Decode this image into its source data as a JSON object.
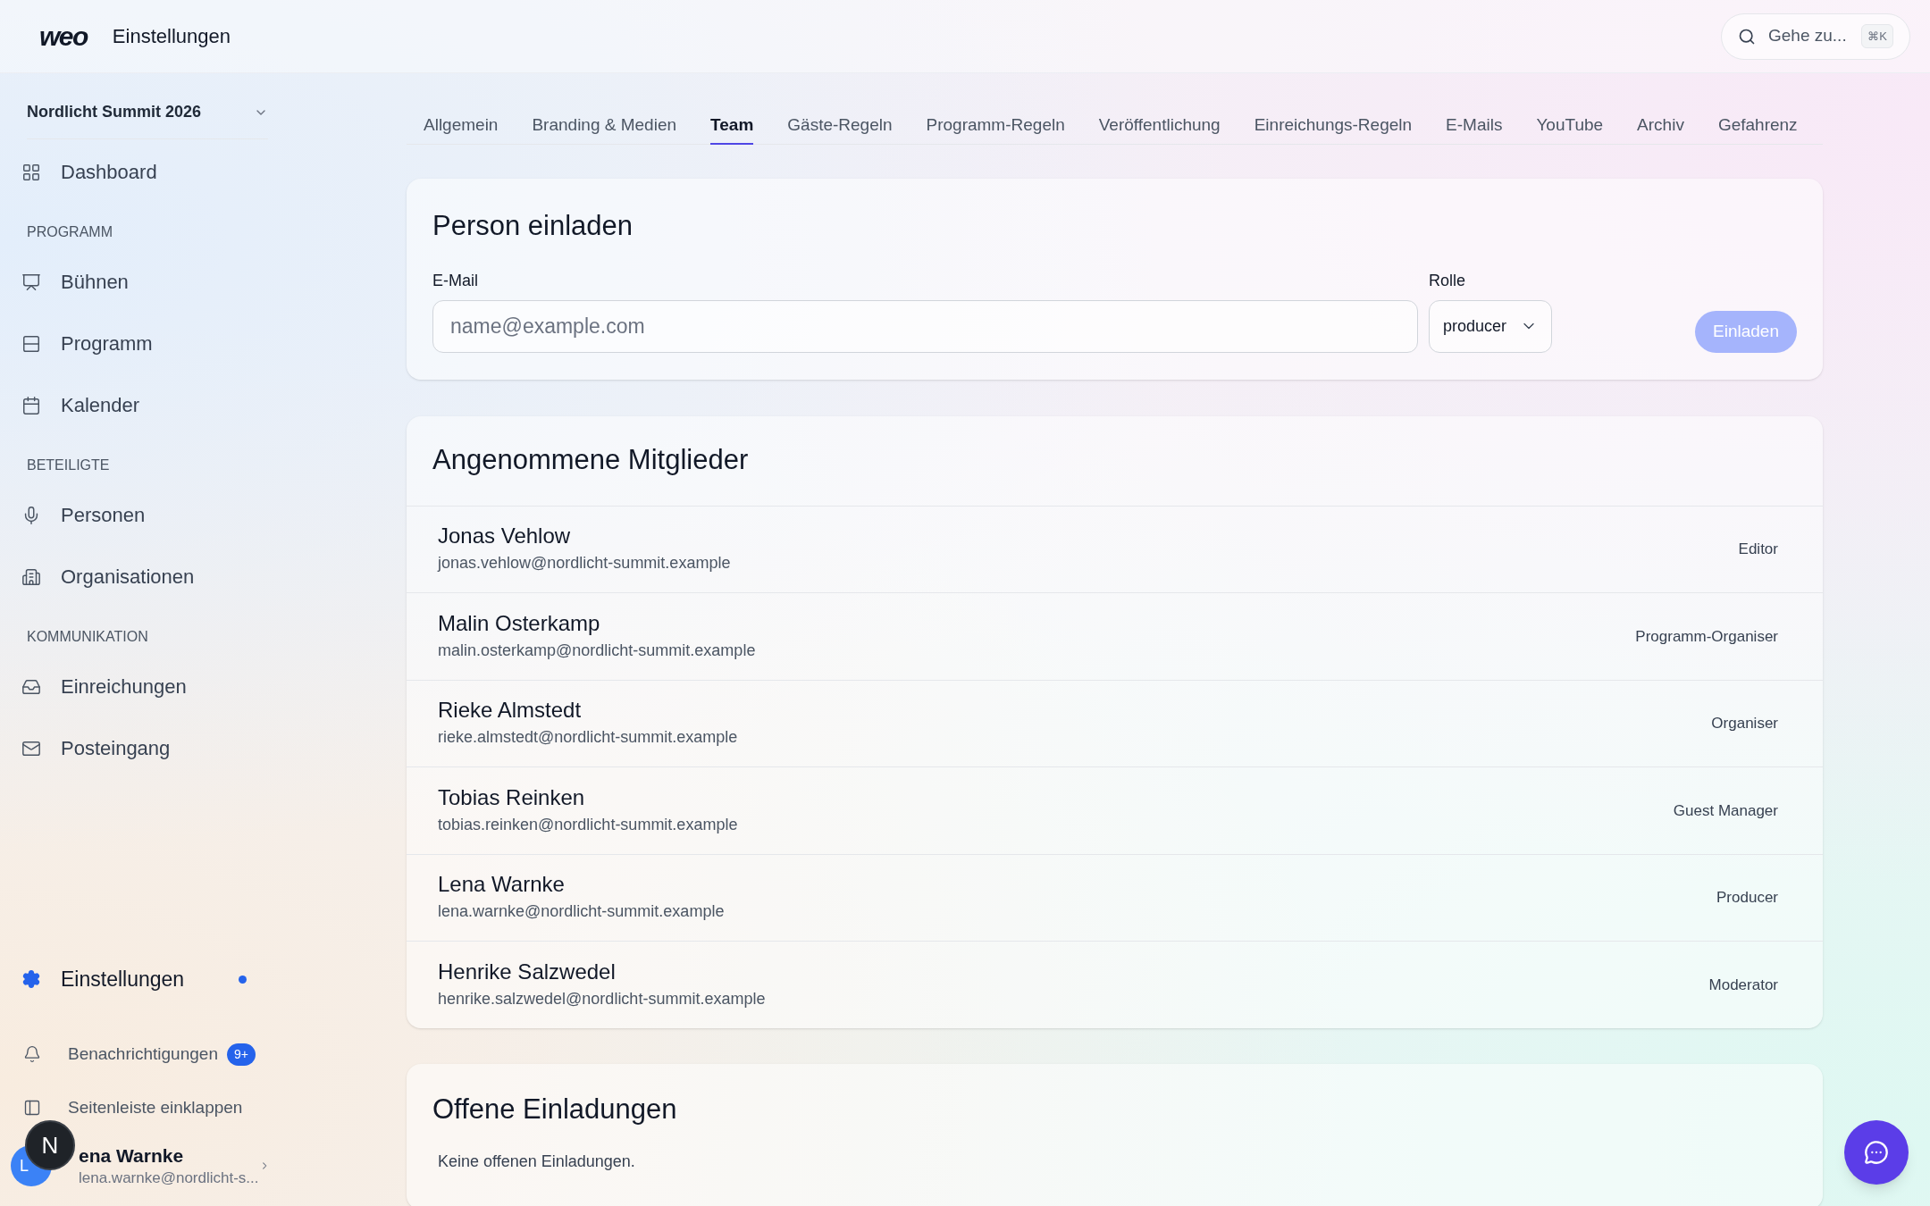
{
  "header": {
    "logo": "weo",
    "title": "Einstellungen",
    "search": {
      "placeholder": "Gehe zu...",
      "shortcut": "⌘K"
    }
  },
  "sidebar": {
    "project": "Nordlicht Summit 2026",
    "groups": [
      {
        "items": [
          {
            "label": "Dashboard",
            "selected": false
          }
        ]
      },
      {
        "heading": "PROGRAMM",
        "items": [
          {
            "label": "Bühnen",
            "selected": false
          },
          {
            "label": "Programm",
            "selected": false
          },
          {
            "label": "Kalender",
            "selected": false
          }
        ]
      },
      {
        "heading": "BETEILIGTE",
        "items": [
          {
            "label": "Personen",
            "selected": false
          },
          {
            "label": "Organisationen",
            "selected": false
          }
        ]
      },
      {
        "heading": "KOMMUNIKATION",
        "items": [
          {
            "label": "Einreichungen",
            "selected": false
          },
          {
            "label": "Posteingang",
            "selected": false
          }
        ]
      }
    ],
    "settings": {
      "label": "Einstellungen",
      "selected": true
    },
    "notifications": {
      "label": "Benachrichtigungen",
      "badge": "9+"
    },
    "collapse": {
      "label": "Seitenleiste einklappen"
    },
    "user": {
      "initials": "L",
      "name": "ena Warnke",
      "email": "lena.warnke@nordlicht-s..."
    }
  },
  "dev_badge": {
    "label": "N"
  },
  "tabs": [
    {
      "label": "Allgemein",
      "selected": false
    },
    {
      "label": "Branding & Medien",
      "selected": false
    },
    {
      "label": "Team",
      "selected": true
    },
    {
      "label": "Gäste-Regeln",
      "selected": false
    },
    {
      "label": "Programm-Regeln",
      "selected": false
    },
    {
      "label": "Veröffentlichung",
      "selected": false
    },
    {
      "label": "Einreichungs-Regeln",
      "selected": false
    },
    {
      "label": "E-Mails",
      "selected": false
    },
    {
      "label": "YouTube",
      "selected": false
    },
    {
      "label": "Archiv",
      "selected": false
    },
    {
      "label": "Gefahrenz",
      "selected": false
    }
  ],
  "invite": {
    "title": "Person einladen",
    "email_label": "E-Mail",
    "email_placeholder": "name@example.com",
    "role_label": "Rolle",
    "role": "producer",
    "button": {
      "label": "Einladen",
      "disabled": true
    }
  },
  "members": {
    "title": "Angenommene Mitglieder",
    "rows": [
      {
        "name": "Jonas Vehlow",
        "email": "jonas.vehlow@nordlicht-summit.example",
        "role": "Editor"
      },
      {
        "name": "Malin Osterkamp",
        "email": "malin.osterkamp@nordlicht-summit.example",
        "role": "Programm-Organiser"
      },
      {
        "name": "Rieke Almstedt",
        "email": "rieke.almstedt@nordlicht-summit.example",
        "role": "Organiser"
      },
      {
        "name": "Tobias Reinken",
        "email": "tobias.reinken@nordlicht-summit.example",
        "role": "Guest Manager"
      },
      {
        "name": "Lena Warnke",
        "email": "lena.warnke@nordlicht-summit.example",
        "role": "Producer"
      },
      {
        "name": "Henrike Salzwedel",
        "email": "henrike.salzwedel@nordlicht-summit.example",
        "role": "Moderator"
      }
    ]
  },
  "pending": {
    "title": "Offene Einladungen",
    "empty_text": "Keine offenen Einladungen."
  }
}
